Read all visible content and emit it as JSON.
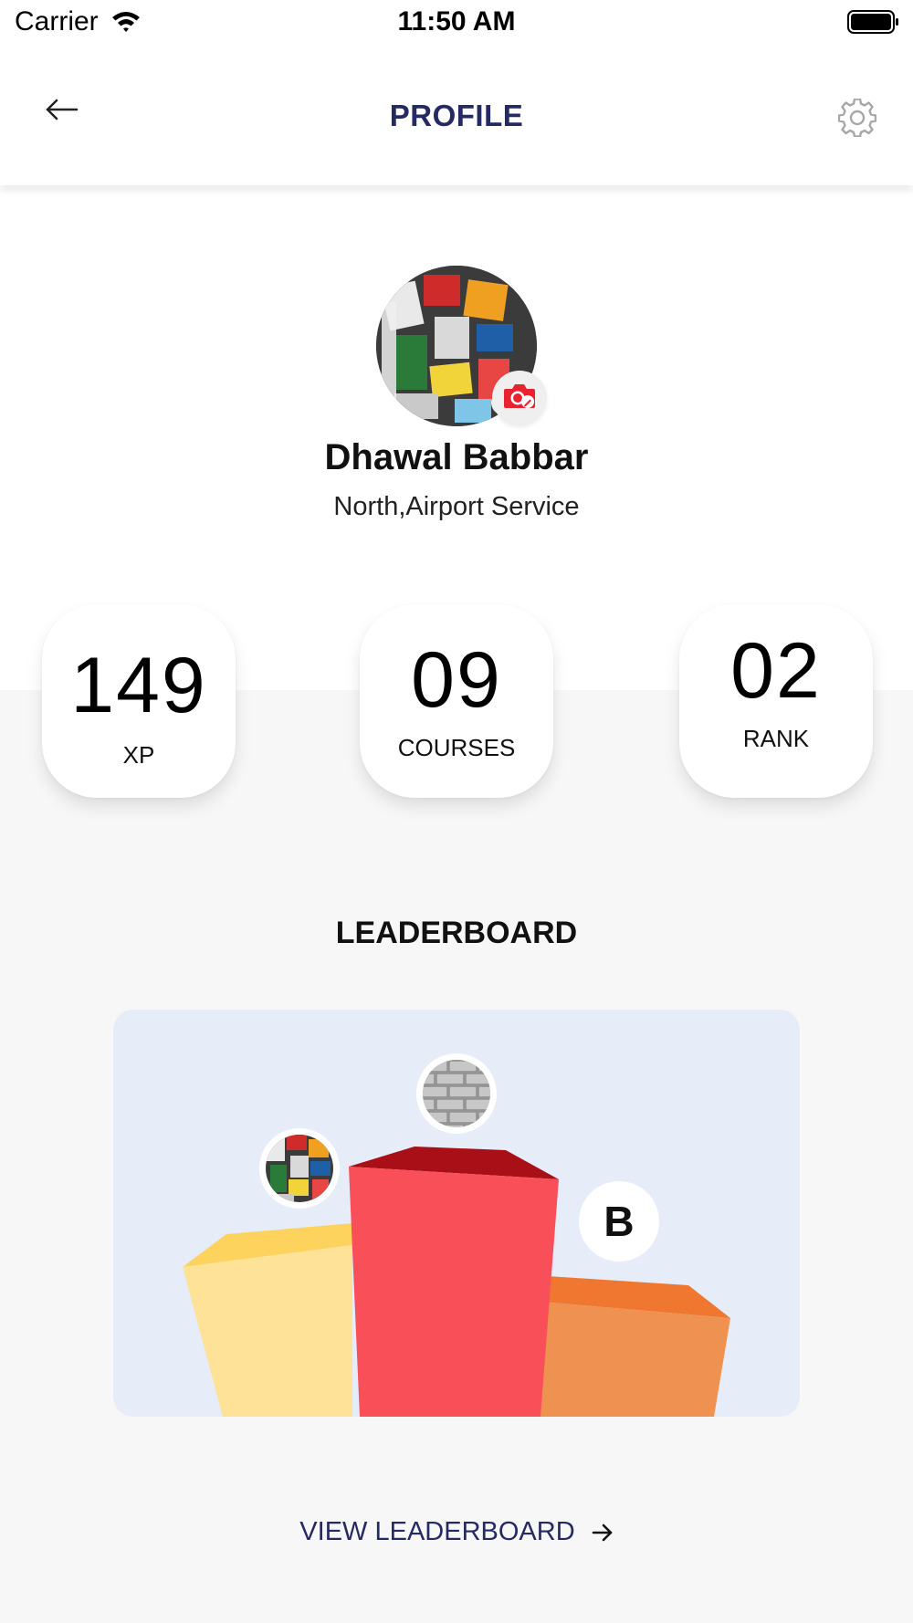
{
  "status_bar": {
    "carrier": "Carrier",
    "time": "11:50 AM",
    "icons": [
      "wifi-icon",
      "battery-icon"
    ]
  },
  "header": {
    "title": "PROFILE",
    "back_icon": "arrow-left-icon",
    "settings_icon": "gear-icon"
  },
  "profile": {
    "name": "Dhawal Babbar",
    "meta": "North,Airport Service",
    "avatar_icon": "user-avatar",
    "edit_photo_icon": "camera-edit-icon"
  },
  "stats": [
    {
      "value": "149",
      "label": "XP"
    },
    {
      "value": "09",
      "label": "COURSES"
    },
    {
      "value": "02",
      "label": "RANK"
    }
  ],
  "leaderboard": {
    "title": "LEADERBOARD",
    "podium": {
      "first_avatar_icon": "brick-wall-avatar",
      "second_avatar_icon": "sticker-avatar",
      "third_initial": "B",
      "colors": {
        "first": "#f94f58",
        "second": "#fde298",
        "third": "#ef9150",
        "background": "#e6edf8"
      }
    },
    "view_all_label": "VIEW LEADERBOARD",
    "view_all_icon": "arrow-right-icon"
  },
  "colors": {
    "title": "#252a63",
    "camera_badge": "#e8232f"
  }
}
